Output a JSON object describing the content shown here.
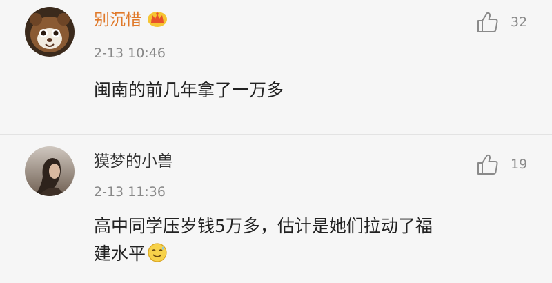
{
  "comments": [
    {
      "username": "别沉惜",
      "badge_icon": "crown-vip-icon",
      "timestamp": "2-13 10:46",
      "body": "闽南的前几年拿了一万多",
      "like_count": "32",
      "name_color": "#e0792a"
    },
    {
      "username": "獏梦的小兽",
      "timestamp": "2-13 11:36",
      "body_line1": "高中同学压岁钱5万多，估计是她们拉动了福",
      "body_line2": "建水平",
      "trailing_emoji": "sweat-smile-emoji",
      "like_count": "19",
      "name_color": "#333333"
    }
  ],
  "icons": {
    "like": "thumbs-up-icon"
  }
}
